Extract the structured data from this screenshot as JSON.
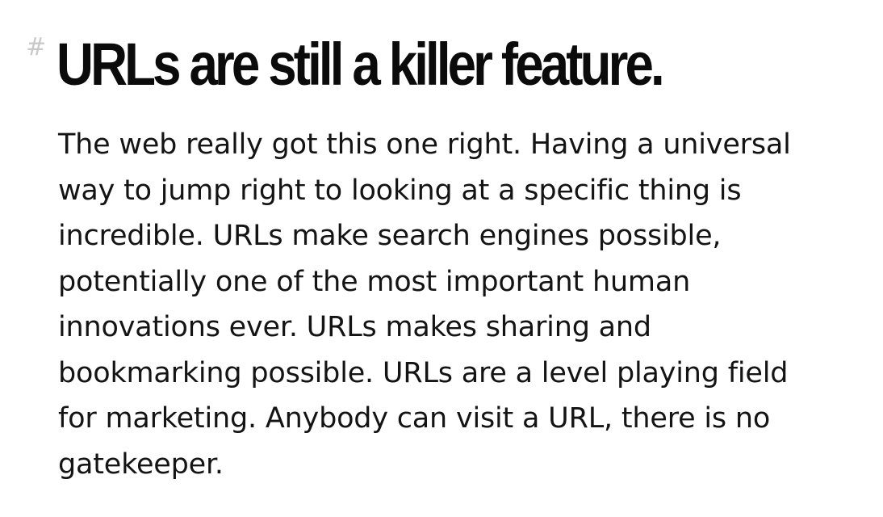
{
  "section": {
    "anchor_symbol": "#",
    "heading": "URLs are still a killer feature.",
    "paragraph_lines": [
      "The web really got this one right. Having a universal",
      "way to jump right to looking at a specific thing is",
      "incredible. URLs make search engines possible,",
      "potentially one of the most important human",
      "innovations ever. URLs makes sharing and",
      "bookmarking possible. URLs are a level playing field",
      "for marketing. Anybody can visit a URL, there is no",
      "gatekeeper."
    ]
  },
  "colors": {
    "heading": "#0b0b0b",
    "body": "#141414",
    "anchor": "#c8c8c8",
    "background": "#ffffff"
  }
}
